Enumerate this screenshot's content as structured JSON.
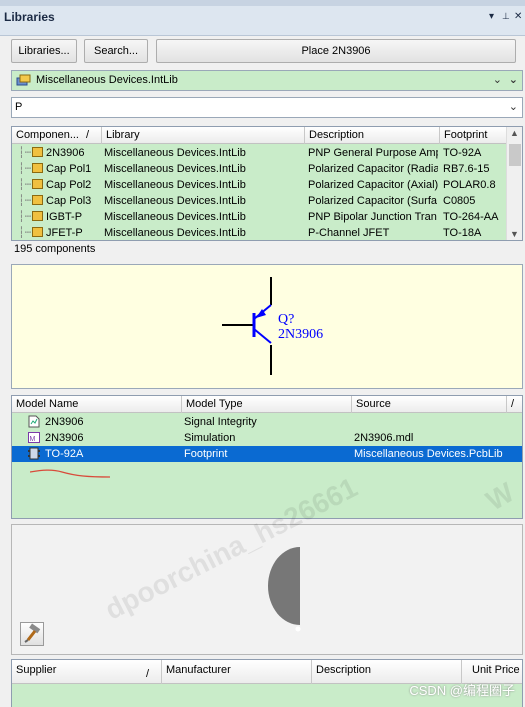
{
  "panel": {
    "title": "Libraries",
    "pin_glyph": "▾",
    "pin2_glyph": "📌",
    "close_glyph": "✕"
  },
  "toolbar": {
    "libraries_label": "Libraries...",
    "search_label": "Search...",
    "place_label": "Place 2N3906"
  },
  "library_selector": {
    "value": "Miscellaneous Devices.IntLib"
  },
  "filter": {
    "value": "P"
  },
  "components": {
    "headers": [
      "Componen...",
      "/",
      "Library",
      "Description",
      "Footprint"
    ],
    "rows": [
      {
        "name": "2N3906",
        "library": "Miscellaneous Devices.IntLib",
        "description": "PNP General Purpose Amp",
        "footprint": "TO-92A"
      },
      {
        "name": "Cap Pol1",
        "library": "Miscellaneous Devices.IntLib",
        "description": "Polarized Capacitor (Radia",
        "footprint": "RB7.6-15"
      },
      {
        "name": "Cap Pol2",
        "library": "Miscellaneous Devices.IntLib",
        "description": "Polarized Capacitor (Axial)",
        "footprint": "POLAR0.8"
      },
      {
        "name": "Cap Pol3",
        "library": "Miscellaneous Devices.IntLib",
        "description": "Polarized Capacitor (Surfa",
        "footprint": "C0805"
      },
      {
        "name": "IGBT-P",
        "library": "Miscellaneous Devices.IntLib",
        "description": "PNP Bipolar Junction Tran",
        "footprint": "TO-264-AA"
      },
      {
        "name": "JFET-P",
        "library": "Miscellaneous Devices.IntLib",
        "description": "P-Channel JFET",
        "footprint": "TO-18A"
      }
    ],
    "count_label": "195 components"
  },
  "schematic": {
    "designator": "Q?",
    "comment": "2N3906"
  },
  "models": {
    "headers": [
      "Model Name",
      "Model Type",
      "Source",
      "/"
    ],
    "rows": [
      {
        "name": "2N3906",
        "type": "Signal Integrity",
        "source": "",
        "icon": "signal-integrity-icon"
      },
      {
        "name": "2N3906",
        "type": "Simulation",
        "source": "2N3906.mdl",
        "icon": "simulation-icon"
      },
      {
        "name": "TO-92A",
        "type": "Footprint",
        "source": "Miscellaneous Devices.PcbLib",
        "icon": "footprint-icon",
        "selected": true
      }
    ]
  },
  "supplier": {
    "headers": [
      "Supplier",
      "/",
      "Manufacturer",
      "Description",
      "Unit Price"
    ]
  },
  "watermark": {
    "text1": "dpoorchina_hs26661",
    "text2": "W",
    "csdn": "CSDN @编程圈子"
  },
  "colors": {
    "row_bg": "#c9ecc9",
    "selection": "#0a6ad2",
    "schematic_bg": "#ffffe1",
    "symbol": "#0000ff"
  }
}
